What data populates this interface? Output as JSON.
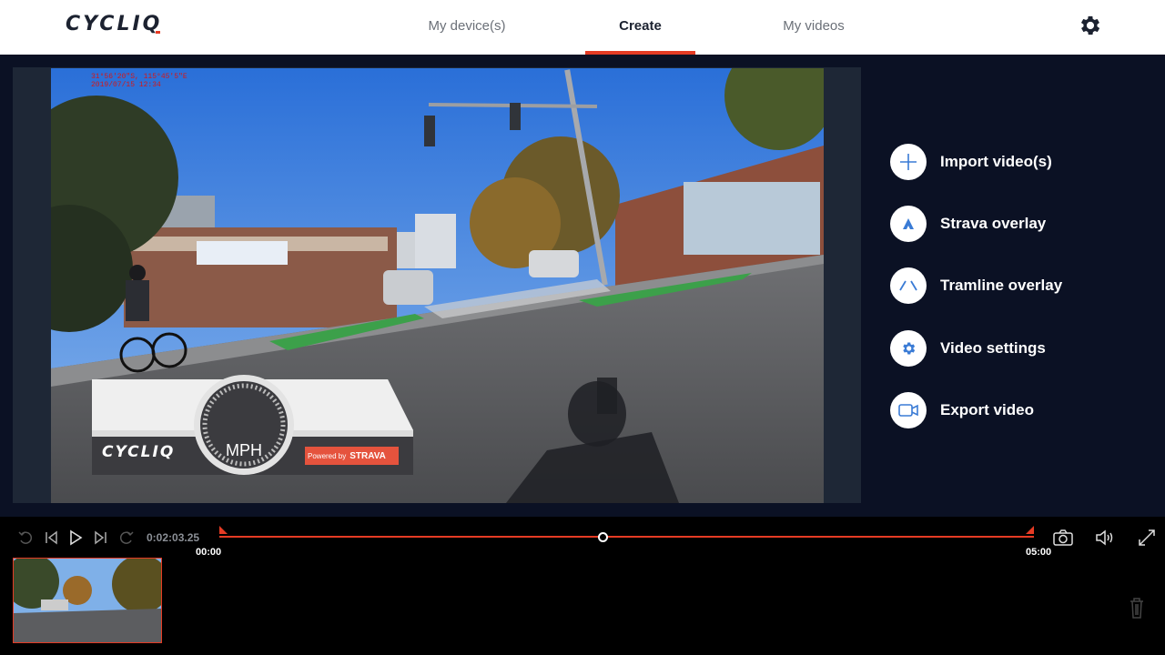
{
  "header": {
    "logo": "CYCLIQ",
    "tabs": [
      {
        "label": "My device(s)",
        "active": false
      },
      {
        "label": "Create",
        "active": true
      },
      {
        "label": "My videos",
        "active": false
      }
    ],
    "settings_icon": "gear-icon",
    "accent_color": "#e53b24"
  },
  "video": {
    "gps_line1": "31°56'20\"S, 115°45'5\"E",
    "gps_line2": "2019/07/15 12:34",
    "overlay": {
      "logo": "CYCLIQ",
      "speed_unit": "MPH",
      "powered_by": "Powered by",
      "brand": "STRAVA"
    }
  },
  "actions": [
    {
      "label": "Import video(s)",
      "icon": "plus-icon"
    },
    {
      "label": "Strava overlay",
      "icon": "strava-icon"
    },
    {
      "label": "Tramline overlay",
      "icon": "tramline-icon"
    },
    {
      "label": "Video settings",
      "icon": "gear-icon"
    },
    {
      "label": "Export video",
      "icon": "video-camera-icon"
    }
  ],
  "player": {
    "current_time": "0:02:03.25",
    "start_label": "00:00",
    "end_label": "05:00",
    "playhead_fraction": 0.47
  }
}
